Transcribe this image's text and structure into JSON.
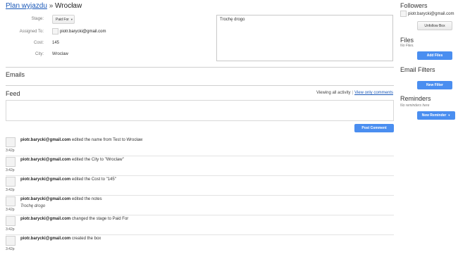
{
  "breadcrumb": {
    "parent": "Plan wyjazdu",
    "separator": "»",
    "current": "Wrocław"
  },
  "fields": {
    "stage_label": "Stage:",
    "stage_value": "Paid For",
    "assigned_label": "Assigned To:",
    "assigned_value": "piotr.barycki@gmail.com",
    "cost_label": "Cost:",
    "cost_value": "145",
    "city_label": "City:",
    "city_value": "Wroclaw"
  },
  "notes": {
    "value": "Trochę drogo"
  },
  "sections": {
    "emails": "Emails",
    "feed": "Feed"
  },
  "feed_filter": {
    "viewing_all": "Viewing all activity",
    "separator": "|",
    "view_comments": "View only comments"
  },
  "comment": {
    "placeholder": "",
    "post_label": "Post Comment"
  },
  "activities": [
    {
      "user": "piotr.barycki@gmail.com",
      "text": "edited the name from Test to Wrocław",
      "time": "3:42p",
      "detail": ""
    },
    {
      "user": "piotr.barycki@gmail.com",
      "text": "edited the City to \"Wroclaw\"",
      "time": "3:42p",
      "detail": ""
    },
    {
      "user": "piotr.barycki@gmail.com",
      "text": "edited the Cost to \"145\"",
      "time": "3:42p",
      "detail": ""
    },
    {
      "user": "piotr.barycki@gmail.com",
      "text": "edited the notes",
      "time": "3:42p",
      "detail": "Trochę drogo"
    },
    {
      "user": "piotr.barycki@gmail.com",
      "text": "changed the stage to Paid For",
      "time": "3:42p",
      "detail": ""
    },
    {
      "user": "piotr.barycki@gmail.com",
      "text": "created the box",
      "time": "3:42p",
      "detail": ""
    }
  ],
  "sidebar": {
    "followers_title": "Followers",
    "follower_email": "piotr.barycki@gmail.com",
    "unfollow_label": "Unfollow Box",
    "files_title": "Files",
    "files_note": "No Files.",
    "add_files_label": "Add Files",
    "filters_title": "Email Filters",
    "new_filter_label": "New Filter",
    "reminders_title": "Reminders",
    "reminders_note": "No reminders here",
    "new_reminder_label": "New Reminder"
  },
  "colors": {
    "accent": "#4a8ef0",
    "link": "#1a58b8"
  }
}
